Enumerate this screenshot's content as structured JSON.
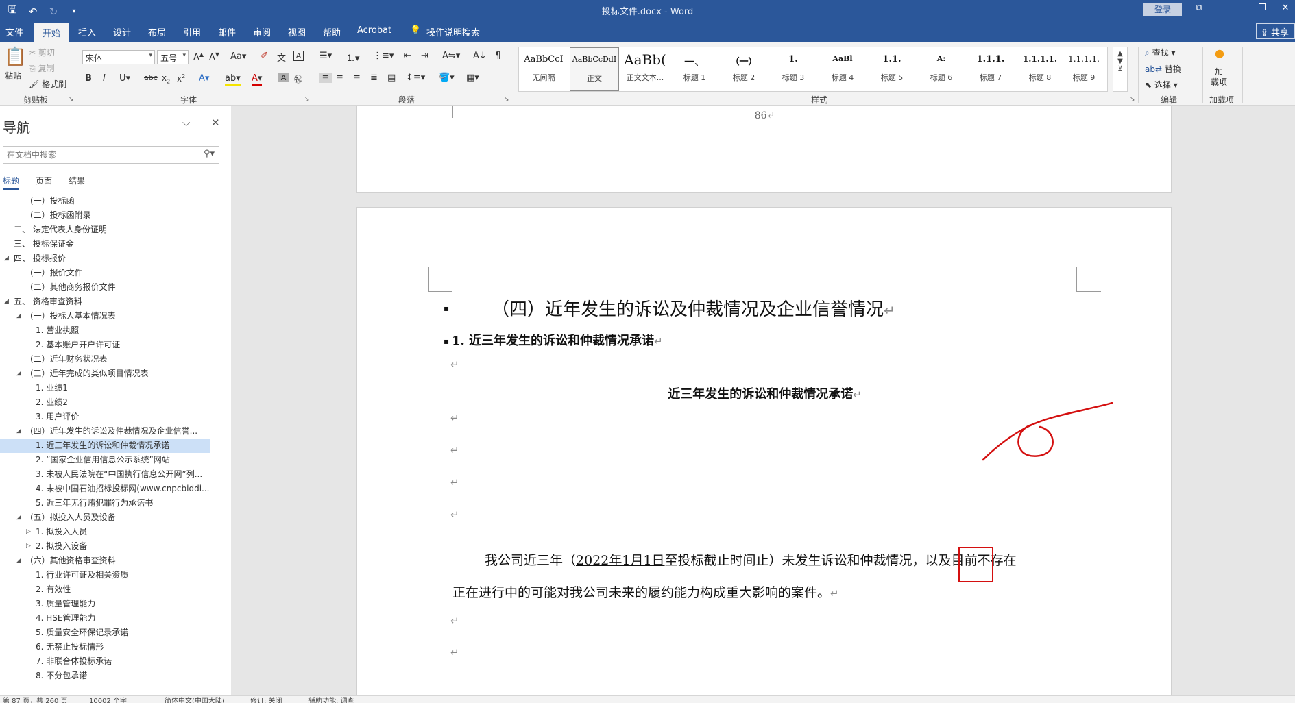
{
  "window": {
    "title": "投标文件.docx  -  Word",
    "login_label": "登录",
    "share_label": "共享"
  },
  "tabs": [
    "文件",
    "开始",
    "插入",
    "设计",
    "布局",
    "引用",
    "邮件",
    "审阅",
    "视图",
    "帮助",
    "Acrobat",
    "操作说明搜索"
  ],
  "ribbon": {
    "clipboard": {
      "paste": "粘贴",
      "cut": "剪切",
      "copy": "复制",
      "format_painter": "格式刷",
      "label": "剪贴板"
    },
    "font": {
      "font_name": "宋体",
      "font_size": "五号",
      "label": "字体",
      "change_case": "Aa"
    },
    "paragraph": {
      "label": "段落"
    },
    "styles": {
      "label": "样式",
      "items": [
        {
          "sample": "AaBbCcI",
          "name": "无间隔"
        },
        {
          "sample": "AaBbCcDdI",
          "name": "正文"
        },
        {
          "sample": "AaBb(",
          "name": "正文文本..."
        },
        {
          "sample": "一、",
          "name": "标题 1"
        },
        {
          "sample": "（一）",
          "name": "标题 2"
        },
        {
          "sample": "1.",
          "name": "标题 3"
        },
        {
          "sample": "AaBl",
          "name": "标题 4"
        },
        {
          "sample": "1.1.",
          "name": "标题 5"
        },
        {
          "sample": "A:",
          "name": "标题 6"
        },
        {
          "sample": "1.1.1.",
          "name": "标题 7"
        },
        {
          "sample": "1.1.1.1.",
          "name": "标题 8"
        },
        {
          "sample": "1.1.1.1.",
          "name": "标题 9"
        }
      ]
    },
    "editing": {
      "find": "查找",
      "replace": "替换",
      "select": "选择",
      "label": "编辑"
    },
    "addins": {
      "button": "加\n载项",
      "label": "加载项"
    }
  },
  "nav": {
    "title": "导航",
    "search_placeholder": "在文档中搜索",
    "tabs": [
      "标题",
      "页面",
      "结果"
    ],
    "items": [
      {
        "text": "(一）投标函",
        "level": 1,
        "toggle": ""
      },
      {
        "text": "(二）投标函附录",
        "level": 1,
        "toggle": ""
      },
      {
        "text": "二、 法定代表人身份证明",
        "level": 0,
        "toggle": ""
      },
      {
        "text": "三、 投标保证金",
        "level": 0,
        "toggle": ""
      },
      {
        "text": "四、 投标报价",
        "level": 0,
        "toggle": "◢"
      },
      {
        "text": "(一）报价文件",
        "level": 1,
        "toggle": ""
      },
      {
        "text": "(二）其他商务报价文件",
        "level": 1,
        "toggle": ""
      },
      {
        "text": "五、 资格审查资料",
        "level": 0,
        "toggle": "◢"
      },
      {
        "text": "(一）投标人基本情况表",
        "level": 1,
        "toggle": "◢"
      },
      {
        "text": "1. 营业执照",
        "level": 2,
        "toggle": ""
      },
      {
        "text": "2. 基本账户开户许可证",
        "level": 2,
        "toggle": ""
      },
      {
        "text": "(二）近年财务状况表",
        "level": 1,
        "toggle": ""
      },
      {
        "text": "(三）近年完成的类似项目情况表",
        "level": 1,
        "toggle": "◢"
      },
      {
        "text": "1. 业绩1",
        "level": 2,
        "toggle": ""
      },
      {
        "text": "2. 业绩2",
        "level": 2,
        "toggle": ""
      },
      {
        "text": "3. 用户评价",
        "level": 2,
        "toggle": ""
      },
      {
        "text": "(四）近年发生的诉讼及仲裁情况及企业信誉...",
        "level": 1,
        "toggle": "◢"
      },
      {
        "text": "1. 近三年发生的诉讼和仲裁情况承诺",
        "level": 2,
        "toggle": "",
        "selected": true
      },
      {
        "text": "2. “国家企业信用信息公示系统”网站",
        "level": 2,
        "toggle": ""
      },
      {
        "text": "3. 未被人民法院在“中国执行信息公开网”列...",
        "level": 2,
        "toggle": ""
      },
      {
        "text": "4. 未被中国石油招标投标网(www.cnpcbiddi...",
        "level": 2,
        "toggle": ""
      },
      {
        "text": "5. 近三年无行贿犯罪行为承诺书",
        "level": 2,
        "toggle": ""
      },
      {
        "text": "(五）拟投入人员及设备",
        "level": 1,
        "toggle": "◢"
      },
      {
        "text": "1. 拟投入人员",
        "level": 2,
        "toggle": "▷"
      },
      {
        "text": "2. 拟投入设备",
        "level": 2,
        "toggle": "▷"
      },
      {
        "text": "(六）其他资格审查资料",
        "level": 1,
        "toggle": "◢"
      },
      {
        "text": "1. 行业许可证及相关资质",
        "level": 2,
        "toggle": ""
      },
      {
        "text": "2. 有效性",
        "level": 2,
        "toggle": ""
      },
      {
        "text": "3. 质量管理能力",
        "level": 2,
        "toggle": ""
      },
      {
        "text": "4. HSE管理能力",
        "level": 2,
        "toggle": ""
      },
      {
        "text": "5. 质量安全环保记录承诺",
        "level": 2,
        "toggle": ""
      },
      {
        "text": "6. 无禁止投标情形",
        "level": 2,
        "toggle": ""
      },
      {
        "text": "7. 非联合体投标承诺",
        "level": 2,
        "toggle": ""
      },
      {
        "text": "8. 不分包承诺",
        "level": 2,
        "toggle": ""
      }
    ]
  },
  "document": {
    "page_number": "86↵",
    "heading_main": "（四）近年发生的诉讼及仲裁情况及企业信誉情况",
    "heading_sub": "1. 近三年发生的诉讼和仲裁情况承诺",
    "title_center": "近三年发生的诉讼和仲裁情况承诺",
    "body_part1": "我公司近三年（",
    "body_date": "2022年1月1日",
    "body_part2": "至投标截止时间止）未发生诉讼和仲裁情况，",
    "body_boxed": "以及",
    "body_part3": "目前不存在",
    "body_line2": "正在进行中的可能对我公司未来的履约能力构成重大影响的案件。",
    "para_mark": "↵",
    "bullet": "▪"
  },
  "status": {
    "items": [
      "第 87 页，共 260 页",
      "10002 个字",
      "简体中文(中国大陆)",
      "修订: 关闭",
      "辅助功能: 调查"
    ]
  }
}
